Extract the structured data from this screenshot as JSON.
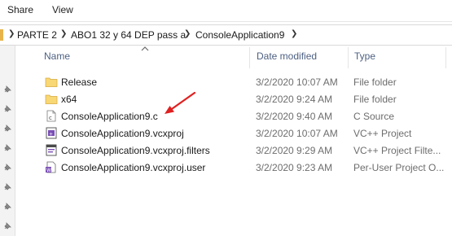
{
  "menu": {
    "share_label": "Share",
    "view_label": "View"
  },
  "breadcrumb": {
    "items": [
      "PARTE 2",
      "ABO1 32 y 64 DEP pass a",
      "ConsoleApplication9"
    ]
  },
  "columns": {
    "name": "Name",
    "date": "Date modified",
    "type": "Type"
  },
  "files": [
    {
      "name": "Release",
      "date": "3/2/2020 10:07 AM",
      "type": "File folder",
      "icon": "folder-icon"
    },
    {
      "name": "x64",
      "date": "3/2/2020 9:24 AM",
      "type": "File folder",
      "icon": "folder-icon"
    },
    {
      "name": "ConsoleApplication9.c",
      "date": "3/2/2020 9:40 AM",
      "type": "C Source",
      "icon": "c-source-file-icon"
    },
    {
      "name": "ConsoleApplication9.vcxproj",
      "date": "3/2/2020 10:07 AM",
      "type": "VC++ Project",
      "icon": "vcxproj-file-icon"
    },
    {
      "name": "ConsoleApplication9.vcxproj.filters",
      "date": "3/2/2020 9:29 AM",
      "type": "VC++ Project Filte...",
      "icon": "filters-file-icon"
    },
    {
      "name": "ConsoleApplication9.vcxproj.user",
      "date": "3/2/2020 9:23 AM",
      "type": "Per-User Project O...",
      "icon": "user-file-icon"
    }
  ],
  "colors": {
    "folder": "#f8d775",
    "header_text": "#4d6082",
    "arrow": "#e02020"
  }
}
